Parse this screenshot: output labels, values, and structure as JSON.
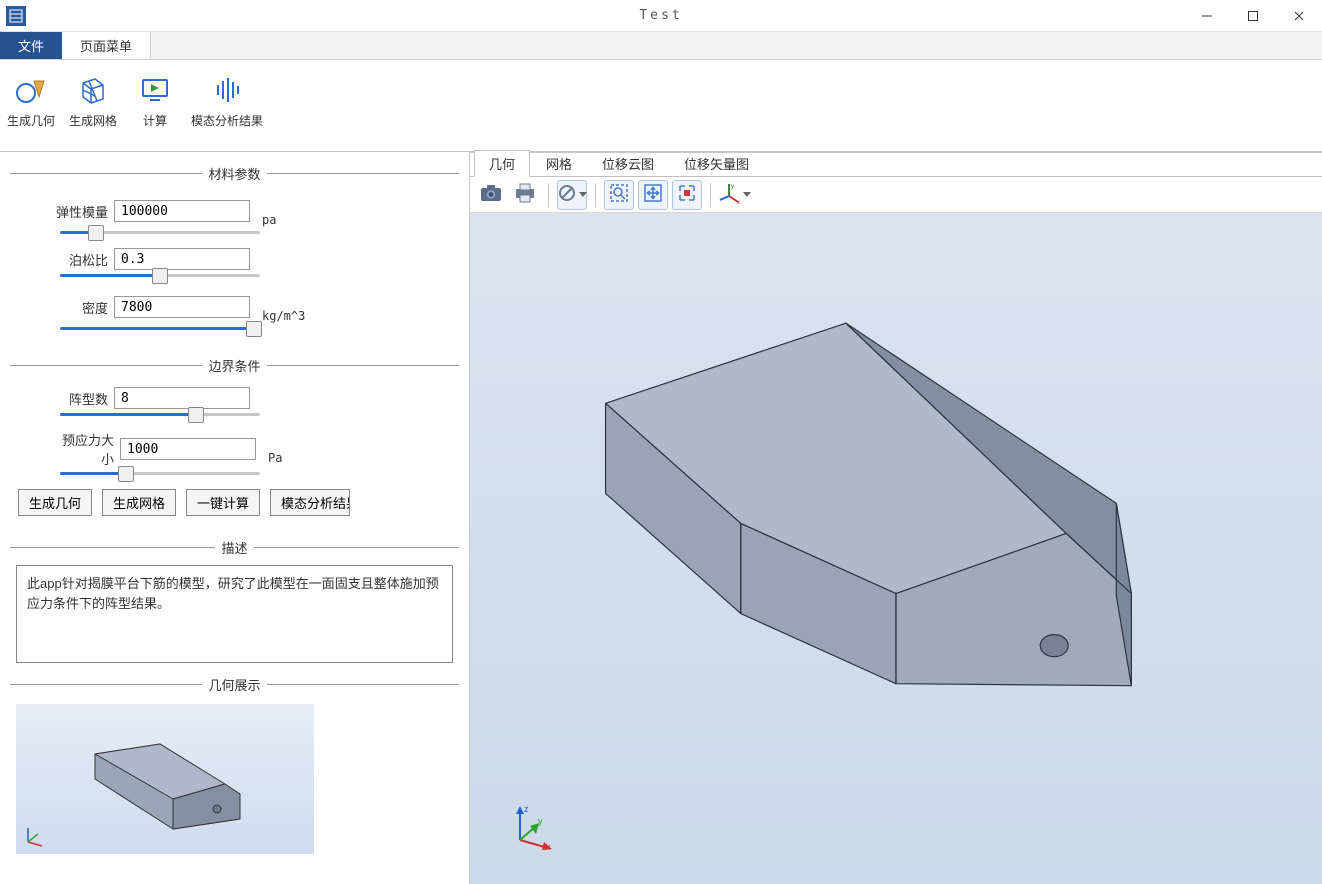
{
  "window": {
    "title": "Test"
  },
  "menuTabs": {
    "file": "文件",
    "page": "页面菜单"
  },
  "ribbon": {
    "genGeom": "生成几何",
    "genMesh": "生成网格",
    "compute": "计算",
    "modal": "模态分析结果"
  },
  "groups": {
    "material": "材料参数",
    "boundary": "边界条件",
    "desc": "描述",
    "geomShow": "几何展示"
  },
  "params": {
    "elastic": {
      "label": "弹性模量",
      "value": "100000",
      "unit": "pa",
      "pct": "18%"
    },
    "poisson": {
      "label": "泊松比",
      "value": "0.3",
      "unit": "",
      "pct": "50%"
    },
    "density": {
      "label": "密度",
      "value": "7800",
      "unit": "kg/m^3",
      "pct": "97%"
    },
    "modes": {
      "label": "阵型数",
      "value": "8",
      "unit": "",
      "pct": "68%"
    },
    "preload": {
      "label": "预应力大小",
      "value": "1000",
      "unit": "Pa",
      "pct": "33%"
    }
  },
  "buttons": {
    "genGeom": "生成几何",
    "genMesh": "生成网格",
    "oneCalc": "一键计算",
    "modalRes": "模态分析结果"
  },
  "description": "此app针对揭膜平台下筋的模型，研究了此模型在一面固支且整体施加预应力条件下的阵型结果。",
  "viewerTabs": {
    "geom": "几何",
    "mesh": "网格",
    "disp": "位移云图",
    "vec": "位移矢量图"
  }
}
